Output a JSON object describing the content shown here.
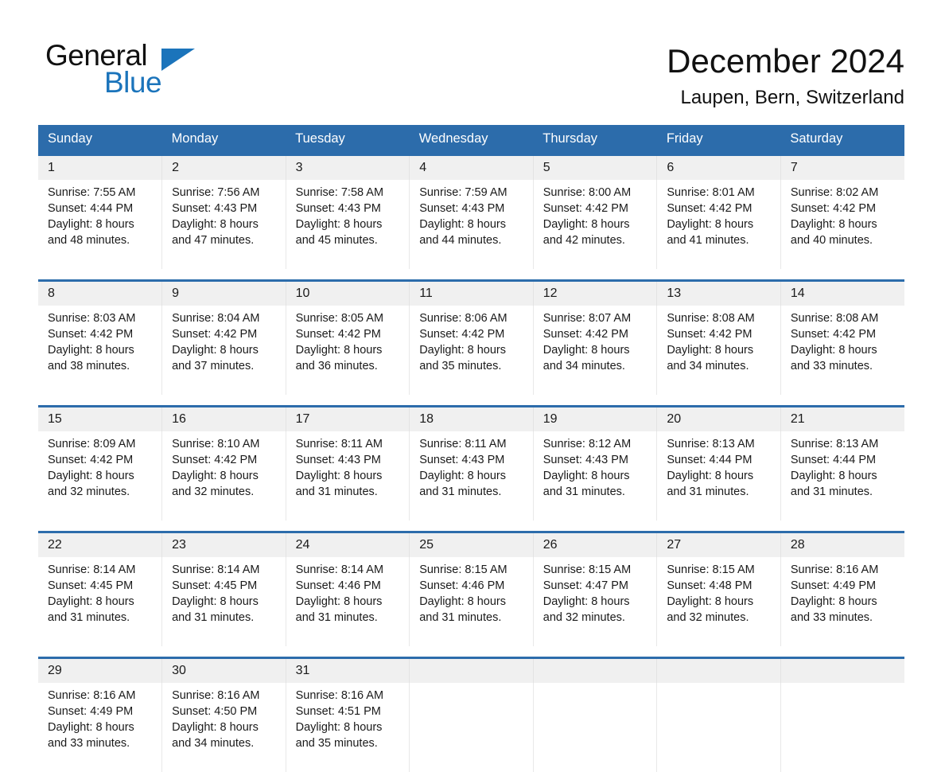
{
  "brand": {
    "name_part1": "General",
    "name_part2": "Blue",
    "accent_color": "#1b74bb"
  },
  "header": {
    "month_title": "December 2024",
    "location": "Laupen, Bern, Switzerland"
  },
  "theme": {
    "header_blue": "#2c6cab",
    "date_band_gray": "#f0f0f0"
  },
  "weekday_headers": [
    "Sunday",
    "Monday",
    "Tuesday",
    "Wednesday",
    "Thursday",
    "Friday",
    "Saturday"
  ],
  "weeks": [
    {
      "days": [
        {
          "date": "1",
          "sunrise": "Sunrise: 7:55 AM",
          "sunset": "Sunset: 4:44 PM",
          "daylight_line1": "Daylight: 8 hours",
          "daylight_line2": "and 48 minutes."
        },
        {
          "date": "2",
          "sunrise": "Sunrise: 7:56 AM",
          "sunset": "Sunset: 4:43 PM",
          "daylight_line1": "Daylight: 8 hours",
          "daylight_line2": "and 47 minutes."
        },
        {
          "date": "3",
          "sunrise": "Sunrise: 7:58 AM",
          "sunset": "Sunset: 4:43 PM",
          "daylight_line1": "Daylight: 8 hours",
          "daylight_line2": "and 45 minutes."
        },
        {
          "date": "4",
          "sunrise": "Sunrise: 7:59 AM",
          "sunset": "Sunset: 4:43 PM",
          "daylight_line1": "Daylight: 8 hours",
          "daylight_line2": "and 44 minutes."
        },
        {
          "date": "5",
          "sunrise": "Sunrise: 8:00 AM",
          "sunset": "Sunset: 4:42 PM",
          "daylight_line1": "Daylight: 8 hours",
          "daylight_line2": "and 42 minutes."
        },
        {
          "date": "6",
          "sunrise": "Sunrise: 8:01 AM",
          "sunset": "Sunset: 4:42 PM",
          "daylight_line1": "Daylight: 8 hours",
          "daylight_line2": "and 41 minutes."
        },
        {
          "date": "7",
          "sunrise": "Sunrise: 8:02 AM",
          "sunset": "Sunset: 4:42 PM",
          "daylight_line1": "Daylight: 8 hours",
          "daylight_line2": "and 40 minutes."
        }
      ]
    },
    {
      "days": [
        {
          "date": "8",
          "sunrise": "Sunrise: 8:03 AM",
          "sunset": "Sunset: 4:42 PM",
          "daylight_line1": "Daylight: 8 hours",
          "daylight_line2": "and 38 minutes."
        },
        {
          "date": "9",
          "sunrise": "Sunrise: 8:04 AM",
          "sunset": "Sunset: 4:42 PM",
          "daylight_line1": "Daylight: 8 hours",
          "daylight_line2": "and 37 minutes."
        },
        {
          "date": "10",
          "sunrise": "Sunrise: 8:05 AM",
          "sunset": "Sunset: 4:42 PM",
          "daylight_line1": "Daylight: 8 hours",
          "daylight_line2": "and 36 minutes."
        },
        {
          "date": "11",
          "sunrise": "Sunrise: 8:06 AM",
          "sunset": "Sunset: 4:42 PM",
          "daylight_line1": "Daylight: 8 hours",
          "daylight_line2": "and 35 minutes."
        },
        {
          "date": "12",
          "sunrise": "Sunrise: 8:07 AM",
          "sunset": "Sunset: 4:42 PM",
          "daylight_line1": "Daylight: 8 hours",
          "daylight_line2": "and 34 minutes."
        },
        {
          "date": "13",
          "sunrise": "Sunrise: 8:08 AM",
          "sunset": "Sunset: 4:42 PM",
          "daylight_line1": "Daylight: 8 hours",
          "daylight_line2": "and 34 minutes."
        },
        {
          "date": "14",
          "sunrise": "Sunrise: 8:08 AM",
          "sunset": "Sunset: 4:42 PM",
          "daylight_line1": "Daylight: 8 hours",
          "daylight_line2": "and 33 minutes."
        }
      ]
    },
    {
      "days": [
        {
          "date": "15",
          "sunrise": "Sunrise: 8:09 AM",
          "sunset": "Sunset: 4:42 PM",
          "daylight_line1": "Daylight: 8 hours",
          "daylight_line2": "and 32 minutes."
        },
        {
          "date": "16",
          "sunrise": "Sunrise: 8:10 AM",
          "sunset": "Sunset: 4:42 PM",
          "daylight_line1": "Daylight: 8 hours",
          "daylight_line2": "and 32 minutes."
        },
        {
          "date": "17",
          "sunrise": "Sunrise: 8:11 AM",
          "sunset": "Sunset: 4:43 PM",
          "daylight_line1": "Daylight: 8 hours",
          "daylight_line2": "and 31 minutes."
        },
        {
          "date": "18",
          "sunrise": "Sunrise: 8:11 AM",
          "sunset": "Sunset: 4:43 PM",
          "daylight_line1": "Daylight: 8 hours",
          "daylight_line2": "and 31 minutes."
        },
        {
          "date": "19",
          "sunrise": "Sunrise: 8:12 AM",
          "sunset": "Sunset: 4:43 PM",
          "daylight_line1": "Daylight: 8 hours",
          "daylight_line2": "and 31 minutes."
        },
        {
          "date": "20",
          "sunrise": "Sunrise: 8:13 AM",
          "sunset": "Sunset: 4:44 PM",
          "daylight_line1": "Daylight: 8 hours",
          "daylight_line2": "and 31 minutes."
        },
        {
          "date": "21",
          "sunrise": "Sunrise: 8:13 AM",
          "sunset": "Sunset: 4:44 PM",
          "daylight_line1": "Daylight: 8 hours",
          "daylight_line2": "and 31 minutes."
        }
      ]
    },
    {
      "days": [
        {
          "date": "22",
          "sunrise": "Sunrise: 8:14 AM",
          "sunset": "Sunset: 4:45 PM",
          "daylight_line1": "Daylight: 8 hours",
          "daylight_line2": "and 31 minutes."
        },
        {
          "date": "23",
          "sunrise": "Sunrise: 8:14 AM",
          "sunset": "Sunset: 4:45 PM",
          "daylight_line1": "Daylight: 8 hours",
          "daylight_line2": "and 31 minutes."
        },
        {
          "date": "24",
          "sunrise": "Sunrise: 8:14 AM",
          "sunset": "Sunset: 4:46 PM",
          "daylight_line1": "Daylight: 8 hours",
          "daylight_line2": "and 31 minutes."
        },
        {
          "date": "25",
          "sunrise": "Sunrise: 8:15 AM",
          "sunset": "Sunset: 4:46 PM",
          "daylight_line1": "Daylight: 8 hours",
          "daylight_line2": "and 31 minutes."
        },
        {
          "date": "26",
          "sunrise": "Sunrise: 8:15 AM",
          "sunset": "Sunset: 4:47 PM",
          "daylight_line1": "Daylight: 8 hours",
          "daylight_line2": "and 32 minutes."
        },
        {
          "date": "27",
          "sunrise": "Sunrise: 8:15 AM",
          "sunset": "Sunset: 4:48 PM",
          "daylight_line1": "Daylight: 8 hours",
          "daylight_line2": "and 32 minutes."
        },
        {
          "date": "28",
          "sunrise": "Sunrise: 8:16 AM",
          "sunset": "Sunset: 4:49 PM",
          "daylight_line1": "Daylight: 8 hours",
          "daylight_line2": "and 33 minutes."
        }
      ]
    },
    {
      "days": [
        {
          "date": "29",
          "sunrise": "Sunrise: 8:16 AM",
          "sunset": "Sunset: 4:49 PM",
          "daylight_line1": "Daylight: 8 hours",
          "daylight_line2": "and 33 minutes."
        },
        {
          "date": "30",
          "sunrise": "Sunrise: 8:16 AM",
          "sunset": "Sunset: 4:50 PM",
          "daylight_line1": "Daylight: 8 hours",
          "daylight_line2": "and 34 minutes."
        },
        {
          "date": "31",
          "sunrise": "Sunrise: 8:16 AM",
          "sunset": "Sunset: 4:51 PM",
          "daylight_line1": "Daylight: 8 hours",
          "daylight_line2": "and 35 minutes."
        },
        {
          "date": "",
          "sunrise": "",
          "sunset": "",
          "daylight_line1": "",
          "daylight_line2": ""
        },
        {
          "date": "",
          "sunrise": "",
          "sunset": "",
          "daylight_line1": "",
          "daylight_line2": ""
        },
        {
          "date": "",
          "sunrise": "",
          "sunset": "",
          "daylight_line1": "",
          "daylight_line2": ""
        },
        {
          "date": "",
          "sunrise": "",
          "sunset": "",
          "daylight_line1": "",
          "daylight_line2": ""
        }
      ]
    }
  ]
}
